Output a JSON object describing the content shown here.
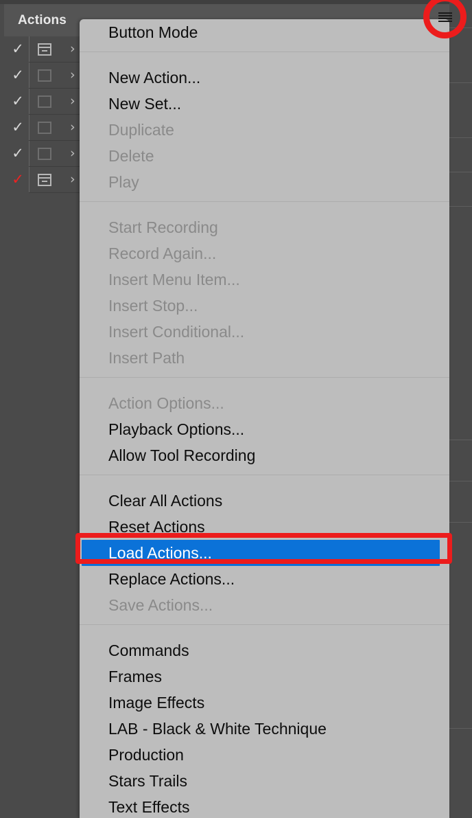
{
  "panel": {
    "tab_label": "Actions",
    "menu_icon": "hamburger-panel-menu-icon",
    "rows": [
      {
        "check": "✓",
        "check_color": "#d8d8d8",
        "box": "dialog-toggle-icon",
        "chevron": "›"
      },
      {
        "check": "✓",
        "check_color": "#d8d8d8",
        "box": "empty-box-icon",
        "chevron": "›"
      },
      {
        "check": "✓",
        "check_color": "#d8d8d8",
        "box": "empty-box-icon",
        "chevron": "›"
      },
      {
        "check": "✓",
        "check_color": "#d8d8d8",
        "box": "empty-box-icon",
        "chevron": "›"
      },
      {
        "check": "✓",
        "check_color": "#d8d8d8",
        "box": "empty-box-icon",
        "chevron": "›"
      },
      {
        "check": "✓",
        "check_color": "#ee2222",
        "box": "dialog-toggle-icon",
        "chevron": "›"
      }
    ]
  },
  "menu": {
    "groups": [
      {
        "items": [
          {
            "label": "Button Mode",
            "enabled": true,
            "selected": false
          }
        ]
      },
      {
        "items": [
          {
            "label": "New Action...",
            "enabled": true,
            "selected": false
          },
          {
            "label": "New Set...",
            "enabled": true,
            "selected": false
          },
          {
            "label": "Duplicate",
            "enabled": false,
            "selected": false
          },
          {
            "label": "Delete",
            "enabled": false,
            "selected": false
          },
          {
            "label": "Play",
            "enabled": false,
            "selected": false
          }
        ]
      },
      {
        "items": [
          {
            "label": "Start Recording",
            "enabled": false,
            "selected": false
          },
          {
            "label": "Record Again...",
            "enabled": false,
            "selected": false
          },
          {
            "label": "Insert Menu Item...",
            "enabled": false,
            "selected": false
          },
          {
            "label": "Insert Stop...",
            "enabled": false,
            "selected": false
          },
          {
            "label": "Insert Conditional...",
            "enabled": false,
            "selected": false
          },
          {
            "label": "Insert Path",
            "enabled": false,
            "selected": false
          }
        ]
      },
      {
        "items": [
          {
            "label": "Action Options...",
            "enabled": false,
            "selected": false
          },
          {
            "label": "Playback Options...",
            "enabled": true,
            "selected": false
          },
          {
            "label": "Allow Tool Recording",
            "enabled": true,
            "selected": false
          }
        ]
      },
      {
        "items": [
          {
            "label": "Clear All Actions",
            "enabled": true,
            "selected": false
          },
          {
            "label": "Reset Actions",
            "enabled": true,
            "selected": false
          },
          {
            "label": "Load Actions...",
            "enabled": true,
            "selected": true
          },
          {
            "label": "Replace Actions...",
            "enabled": true,
            "selected": false
          },
          {
            "label": "Save Actions...",
            "enabled": false,
            "selected": false
          }
        ]
      },
      {
        "items": [
          {
            "label": "Commands",
            "enabled": true,
            "selected": false
          },
          {
            "label": "Frames",
            "enabled": true,
            "selected": false
          },
          {
            "label": "Image Effects",
            "enabled": true,
            "selected": false
          },
          {
            "label": "LAB - Black & White Technique",
            "enabled": true,
            "selected": false
          },
          {
            "label": "Production",
            "enabled": true,
            "selected": false
          },
          {
            "label": "Stars Trails",
            "enabled": true,
            "selected": false
          },
          {
            "label": "Text Effects",
            "enabled": true,
            "selected": false
          }
        ]
      }
    ]
  },
  "annotations": {
    "highlight_color": "#ec1c1c",
    "selection_color": "#0b72d8",
    "box_target": "Load Actions...",
    "circle_target": "panel-menu-icon"
  },
  "colors": {
    "panel_bg": "#4a4a4a",
    "tab_bg": "#545454",
    "menu_bg": "#bdbdbd",
    "menu_text": "#0d0d0d",
    "menu_text_disabled": "#8a8a8a",
    "app_bg": "#535353"
  }
}
